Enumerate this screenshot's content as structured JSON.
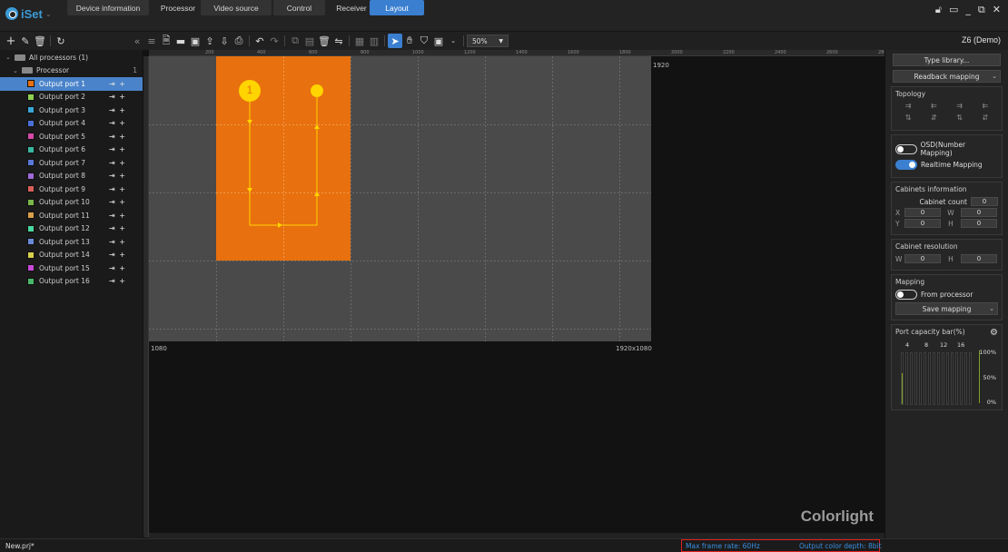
{
  "app": {
    "logo_text": "iSet",
    "nav_tabs": [
      "Device information",
      "Processor",
      "Video source",
      "Control",
      "Receiver",
      "Layout"
    ],
    "active_tab": "Layout",
    "device_name": "Z6 (Demo)",
    "accent_color": "#3b7fd0"
  },
  "toolbar": {
    "zoom": "50%"
  },
  "tree": {
    "root_label": "All processors (1)",
    "processor_label": "Processor",
    "processor_count": "1",
    "ports": [
      {
        "label": "Output port 1",
        "color": "#e8700e",
        "selected": true
      },
      {
        "label": "Output port 2",
        "color": "#8fd14f"
      },
      {
        "label": "Output port 3",
        "color": "#3aa7d8"
      },
      {
        "label": "Output port 4",
        "color": "#4a6fd8"
      },
      {
        "label": "Output port 5",
        "color": "#d84aa8"
      },
      {
        "label": "Output port 6",
        "color": "#3ab8a0"
      },
      {
        "label": "Output port 7",
        "color": "#5a78d8"
      },
      {
        "label": "Output port 8",
        "color": "#a06ad8"
      },
      {
        "label": "Output port 9",
        "color": "#d8605a"
      },
      {
        "label": "Output port 10",
        "color": "#7ab84a"
      },
      {
        "label": "Output port 11",
        "color": "#d8a04a"
      },
      {
        "label": "Output port 12",
        "color": "#4ad8a0"
      },
      {
        "label": "Output port 13",
        "color": "#6a8ad8"
      },
      {
        "label": "Output port 14",
        "color": "#d8d04a"
      },
      {
        "label": "Output port 15",
        "color": "#c84ad8"
      },
      {
        "label": "Output port 16",
        "color": "#4ab86a"
      }
    ]
  },
  "canvas": {
    "width_label": "1920",
    "height_label": "1080",
    "resolution_label": "1920x1080",
    "receiver_number": "1",
    "brand": "Colorlight",
    "port_area_color": "#e8700e",
    "ruler_ticks": [
      "200",
      "400",
      "600",
      "800",
      "1000",
      "1200",
      "1400",
      "1600",
      "1800",
      "2000",
      "2200",
      "2400",
      "2600",
      "2800"
    ]
  },
  "panel": {
    "type_library_label": "Type library...",
    "readback_label": "Readback mapping",
    "topology_title": "Topology",
    "osd_label": "OSD(Number Mapping)",
    "osd_on": false,
    "realtime_label": "Realtime Mapping",
    "realtime_on": true,
    "cabinets_title": "Cabinets information",
    "cabinet_count_label": "Cabinet count",
    "cabinet_count": "0",
    "x_label": "X",
    "x_value": "0",
    "w_label": "W",
    "w_value": "0",
    "y_label": "Y",
    "y_value": "0",
    "h_label": "H",
    "h_value": "0",
    "resolution_title": "Cabinet resolution",
    "res_w_label": "W",
    "res_w_value": "0",
    "res_h_label": "H",
    "res_h_value": "0",
    "mapping_title": "Mapping",
    "from_processor_label": "From processor",
    "from_processor_on": false,
    "save_mapping_label": "Save mapping",
    "capacity_title": "Port capacity bar(%)",
    "capacity_ticks": [
      "4",
      "8",
      "12",
      "16"
    ],
    "capacity_levels": [
      "100%",
      "50%",
      "0%"
    ],
    "port1_capacity": 0.6
  },
  "status": {
    "file": "New.prj*",
    "frame_rate": "Max frame rate: 60Hz",
    "color_depth": "Output color depth: 8bit"
  }
}
